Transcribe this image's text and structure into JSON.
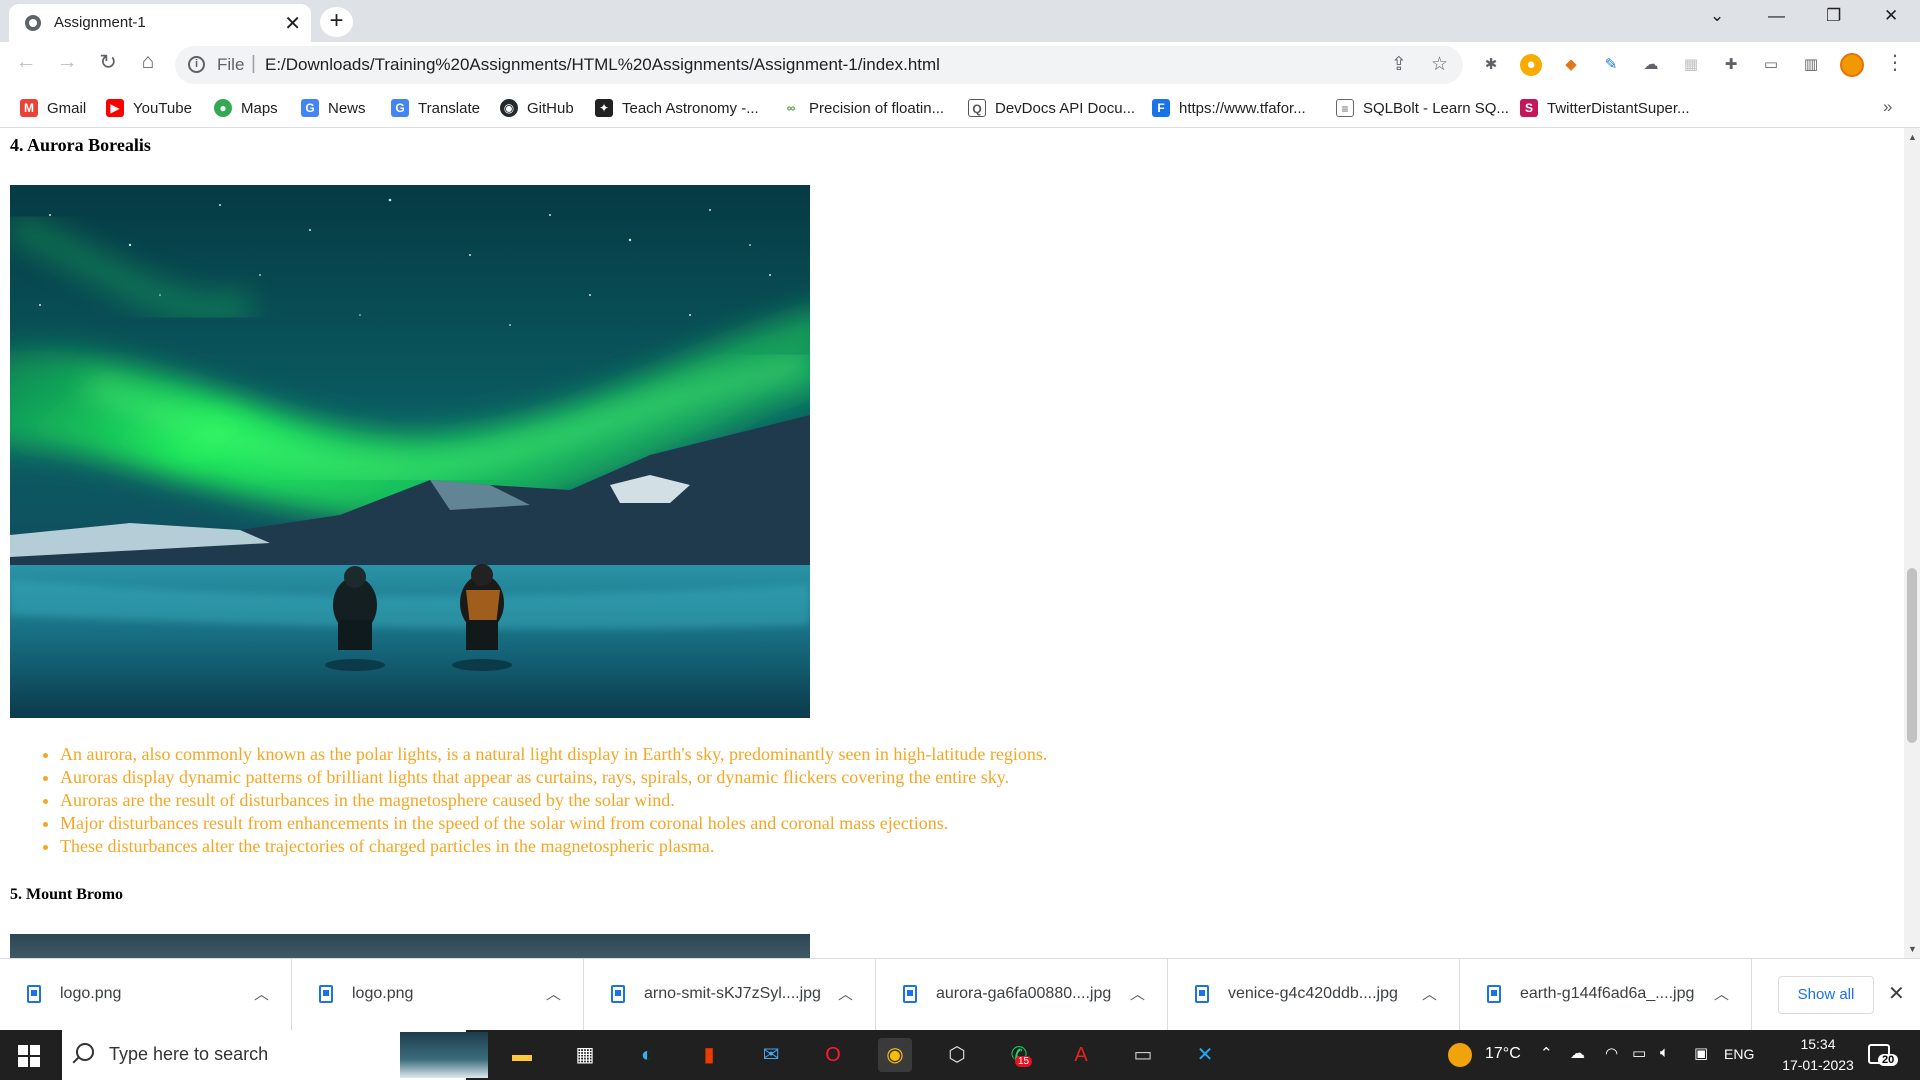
{
  "browser": {
    "tab_title": "Assignment-1",
    "url_scheme": "File",
    "url": "E:/Downloads/Training%20Assignments/HTML%20Assignments/Assignment-1/index.html"
  },
  "bookmarks": [
    {
      "label": "Gmail",
      "icon": "gmail-icon",
      "color": "#ea4335"
    },
    {
      "label": "YouTube",
      "icon": "youtube-icon",
      "color": "#ff0000"
    },
    {
      "label": "Maps",
      "icon": "maps-icon",
      "color": "#34a853"
    },
    {
      "label": "News",
      "icon": "news-icon",
      "color": "#4285f4"
    },
    {
      "label": "Translate",
      "icon": "translate-icon",
      "color": "#4285f4"
    },
    {
      "label": "GitHub",
      "icon": "github-icon",
      "color": "#24292e"
    },
    {
      "label": "Teach Astronomy -...",
      "icon": "astronomy-icon",
      "color": "#222222"
    },
    {
      "label": "Precision of floatin...",
      "icon": "link-icon",
      "color": "#5a9e3a"
    },
    {
      "label": "DevDocs API Docu...",
      "icon": "devdocs-icon",
      "color": "#555555"
    },
    {
      "label": "https://www.tfafor...",
      "icon": "tfa-icon",
      "color": "#1a73e8"
    },
    {
      "label": "SQLBolt - Learn SQ...",
      "icon": "database-icon",
      "color": "#666666"
    },
    {
      "label": "TwitterDistantSuper...",
      "icon": "s-logo-icon",
      "color": "#c2185b"
    }
  ],
  "page": {
    "section4_heading": "4. Aurora Borealis",
    "aurora_facts": [
      "An aurora, also commonly known as the polar lights, is a natural light display in Earth's sky, predominantly seen in high-latitude regions.",
      "Auroras display dynamic patterns of brilliant lights that appear as curtains, rays, spirals, or dynamic flickers covering the entire sky.",
      "Auroras are the result of disturbances in the magnetosphere caused by the solar wind.",
      "Major disturbances result from enhancements in the speed of the solar wind from coronal holes and coronal mass ejections.",
      "These disturbances alter the trajectories of charged particles in the magnetospheric plasma."
    ],
    "section5_heading": "5. Mount Bromo",
    "list_color": "#f5a623"
  },
  "downloads": {
    "items": [
      {
        "name": "logo.png"
      },
      {
        "name": "logo.png"
      },
      {
        "name": "arno-smit-sKJ7zSyl....jpg"
      },
      {
        "name": "aurora-ga6fa00880....jpg"
      },
      {
        "name": "venice-g4c420ddb....jpg"
      },
      {
        "name": "earth-g144f6ad6a_....jpg"
      }
    ],
    "show_all": "Show all"
  },
  "taskbar": {
    "search_placeholder": "Type here to search",
    "temperature": "17°C",
    "language": "ENG",
    "time": "15:34",
    "date": "17-01-2023",
    "notification_count": "20",
    "whatsapp_badge": "15"
  }
}
